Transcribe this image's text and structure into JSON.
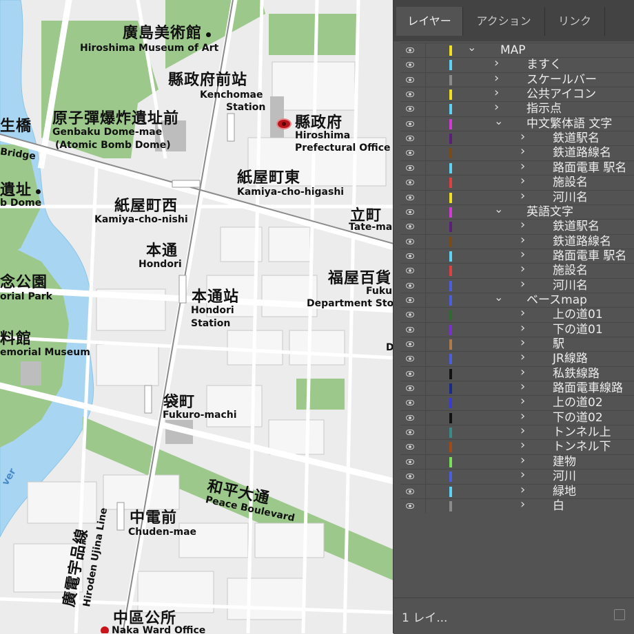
{
  "map": {
    "labels": {
      "museum_art_jp": "廣島美術館",
      "museum_art_en": "Hiroshima Museum of Art",
      "kenchomae_jp": "縣政府前站",
      "kenchomae_en1": "Kenchomae",
      "kenchomae_en2": "Station",
      "kenseifu_jp": "縣政府",
      "kenseifu_en1": "Hiroshima",
      "kenseifu_en2": "Prefectural Office",
      "genbaku_jp": "原子彈爆炸遺址前",
      "genbaku_en1": "Genbaku Dome-mae",
      "genbaku_en2": "(Atomic Bomb Dome)",
      "bridge_jp": "生橋",
      "bridge_en": "Bridge",
      "dome_jp": "遺址",
      "dome_en": "b Dome",
      "kamiyacho_e_jp": "紙屋町東",
      "kamiyacho_e_en": "Kamiya-cho-higashi",
      "kamiyacho_w_jp": "紙屋町西",
      "kamiyacho_w_en": "Kamiya-cho-nishi",
      "tatemachi_jp": "立町",
      "tatemachi_en": "Tate-ma",
      "hondori_jp": "本通",
      "hondori_en": "Hondori",
      "hondori_st_jp": "本通站",
      "hondori_st_en1": "Hondori",
      "hondori_st_en2": "Station",
      "fukuya_jp": "福屋百貨",
      "fukuya_en1": "Fuku",
      "fukuya_en2": "Department Sto",
      "park_jp": "念公園",
      "park_en": "orial Park",
      "museum_jp": "料館",
      "museum_en": "emorial Museum",
      "fukuromachi_jp": "袋町",
      "fukuromachi_en": "Fukuro-machi",
      "peace_blvd_jp": "和平大通",
      "peace_blvd_en": "Peace Boulevard",
      "ujina_jp": "廣電宇品線",
      "ujina_en": "Hiroden Ujina Line",
      "chuden_jp": "中電前",
      "chuden_en": "Chuden-mae",
      "naka_jp": "中區公所",
      "naka_en": "Naka Ward Office",
      "river_en": "ver",
      "d_label": "D"
    }
  },
  "layers_panel": {
    "tabs": [
      "レイヤー",
      "アクション",
      "リンク"
    ],
    "active_tab": 0,
    "rows": [
      {
        "name": "MAP",
        "level": 0,
        "expanded": true,
        "color": "#f2e020"
      },
      {
        "name": "ますく",
        "level": 1,
        "expanded": false,
        "color": "#5ad3f5"
      },
      {
        "name": "スケールバー",
        "level": 1,
        "expanded": false,
        "color": "#8a8a8a"
      },
      {
        "name": "公共アイコン",
        "level": 1,
        "expanded": false,
        "color": "#f2e020"
      },
      {
        "name": "指示点",
        "level": 1,
        "expanded": false,
        "color": "#5ad3f5"
      },
      {
        "name": "中文繁体語 文字",
        "level": 1,
        "expanded": true,
        "color": "#d13ad6"
      },
      {
        "name": "鉄道駅名",
        "level": 2,
        "expanded": false,
        "color": "#5b1f7a"
      },
      {
        "name": "鉄道路線名",
        "level": 2,
        "expanded": false,
        "color": "#7a4a18"
      },
      {
        "name": "路面電車 駅名",
        "level": 2,
        "expanded": false,
        "color": "#5ad3f5"
      },
      {
        "name": "施設名",
        "level": 2,
        "expanded": false,
        "color": "#e04040"
      },
      {
        "name": "河川名",
        "level": 2,
        "expanded": false,
        "color": "#f2e020"
      },
      {
        "name": "英語文字",
        "level": 1,
        "expanded": true,
        "color": "#d13ad6"
      },
      {
        "name": "鉄道駅名",
        "level": 2,
        "expanded": false,
        "color": "#5b1f7a"
      },
      {
        "name": "鉄道路線名",
        "level": 2,
        "expanded": false,
        "color": "#7a4a18"
      },
      {
        "name": "路面電車 駅名",
        "level": 2,
        "expanded": false,
        "color": "#5ad3f5"
      },
      {
        "name": "施設名",
        "level": 2,
        "expanded": false,
        "color": "#e04040"
      },
      {
        "name": "河川名",
        "level": 2,
        "expanded": false,
        "color": "#4a5ee0"
      },
      {
        "name": "ベースmap",
        "level": 1,
        "expanded": true,
        "color": "#4a5ee0"
      },
      {
        "name": "上の道01",
        "level": 2,
        "expanded": false,
        "color": "#2f6a2f"
      },
      {
        "name": "下の道01",
        "level": 2,
        "expanded": false,
        "color": "#7a2fd0"
      },
      {
        "name": "駅",
        "level": 2,
        "expanded": false,
        "color": "#b07a4a"
      },
      {
        "name": "JR線路",
        "level": 2,
        "expanded": false,
        "color": "#4a5ee0"
      },
      {
        "name": "私鉄線路",
        "level": 2,
        "expanded": false,
        "color": "#111111"
      },
      {
        "name": "路面電車線路",
        "level": 2,
        "expanded": false,
        "color": "#1a2a8a"
      },
      {
        "name": "上の道02",
        "level": 2,
        "expanded": false,
        "color": "#3a3ad8"
      },
      {
        "name": "下の道02",
        "level": 2,
        "expanded": false,
        "color": "#111111"
      },
      {
        "name": "トンネル上",
        "level": 2,
        "expanded": false,
        "color": "#3a8a8a"
      },
      {
        "name": "トンネル下",
        "level": 2,
        "expanded": false,
        "color": "#a04a1a"
      },
      {
        "name": "建物",
        "level": 2,
        "expanded": false,
        "color": "#7ae05a"
      },
      {
        "name": "河川",
        "level": 2,
        "expanded": false,
        "color": "#4a5ee0"
      },
      {
        "name": "緑地",
        "level": 2,
        "expanded": false,
        "color": "#5ad3f5"
      },
      {
        "name": "白",
        "level": 2,
        "expanded": false,
        "color": "#8a8a8a"
      }
    ],
    "footer_text": "1 レイ..."
  }
}
